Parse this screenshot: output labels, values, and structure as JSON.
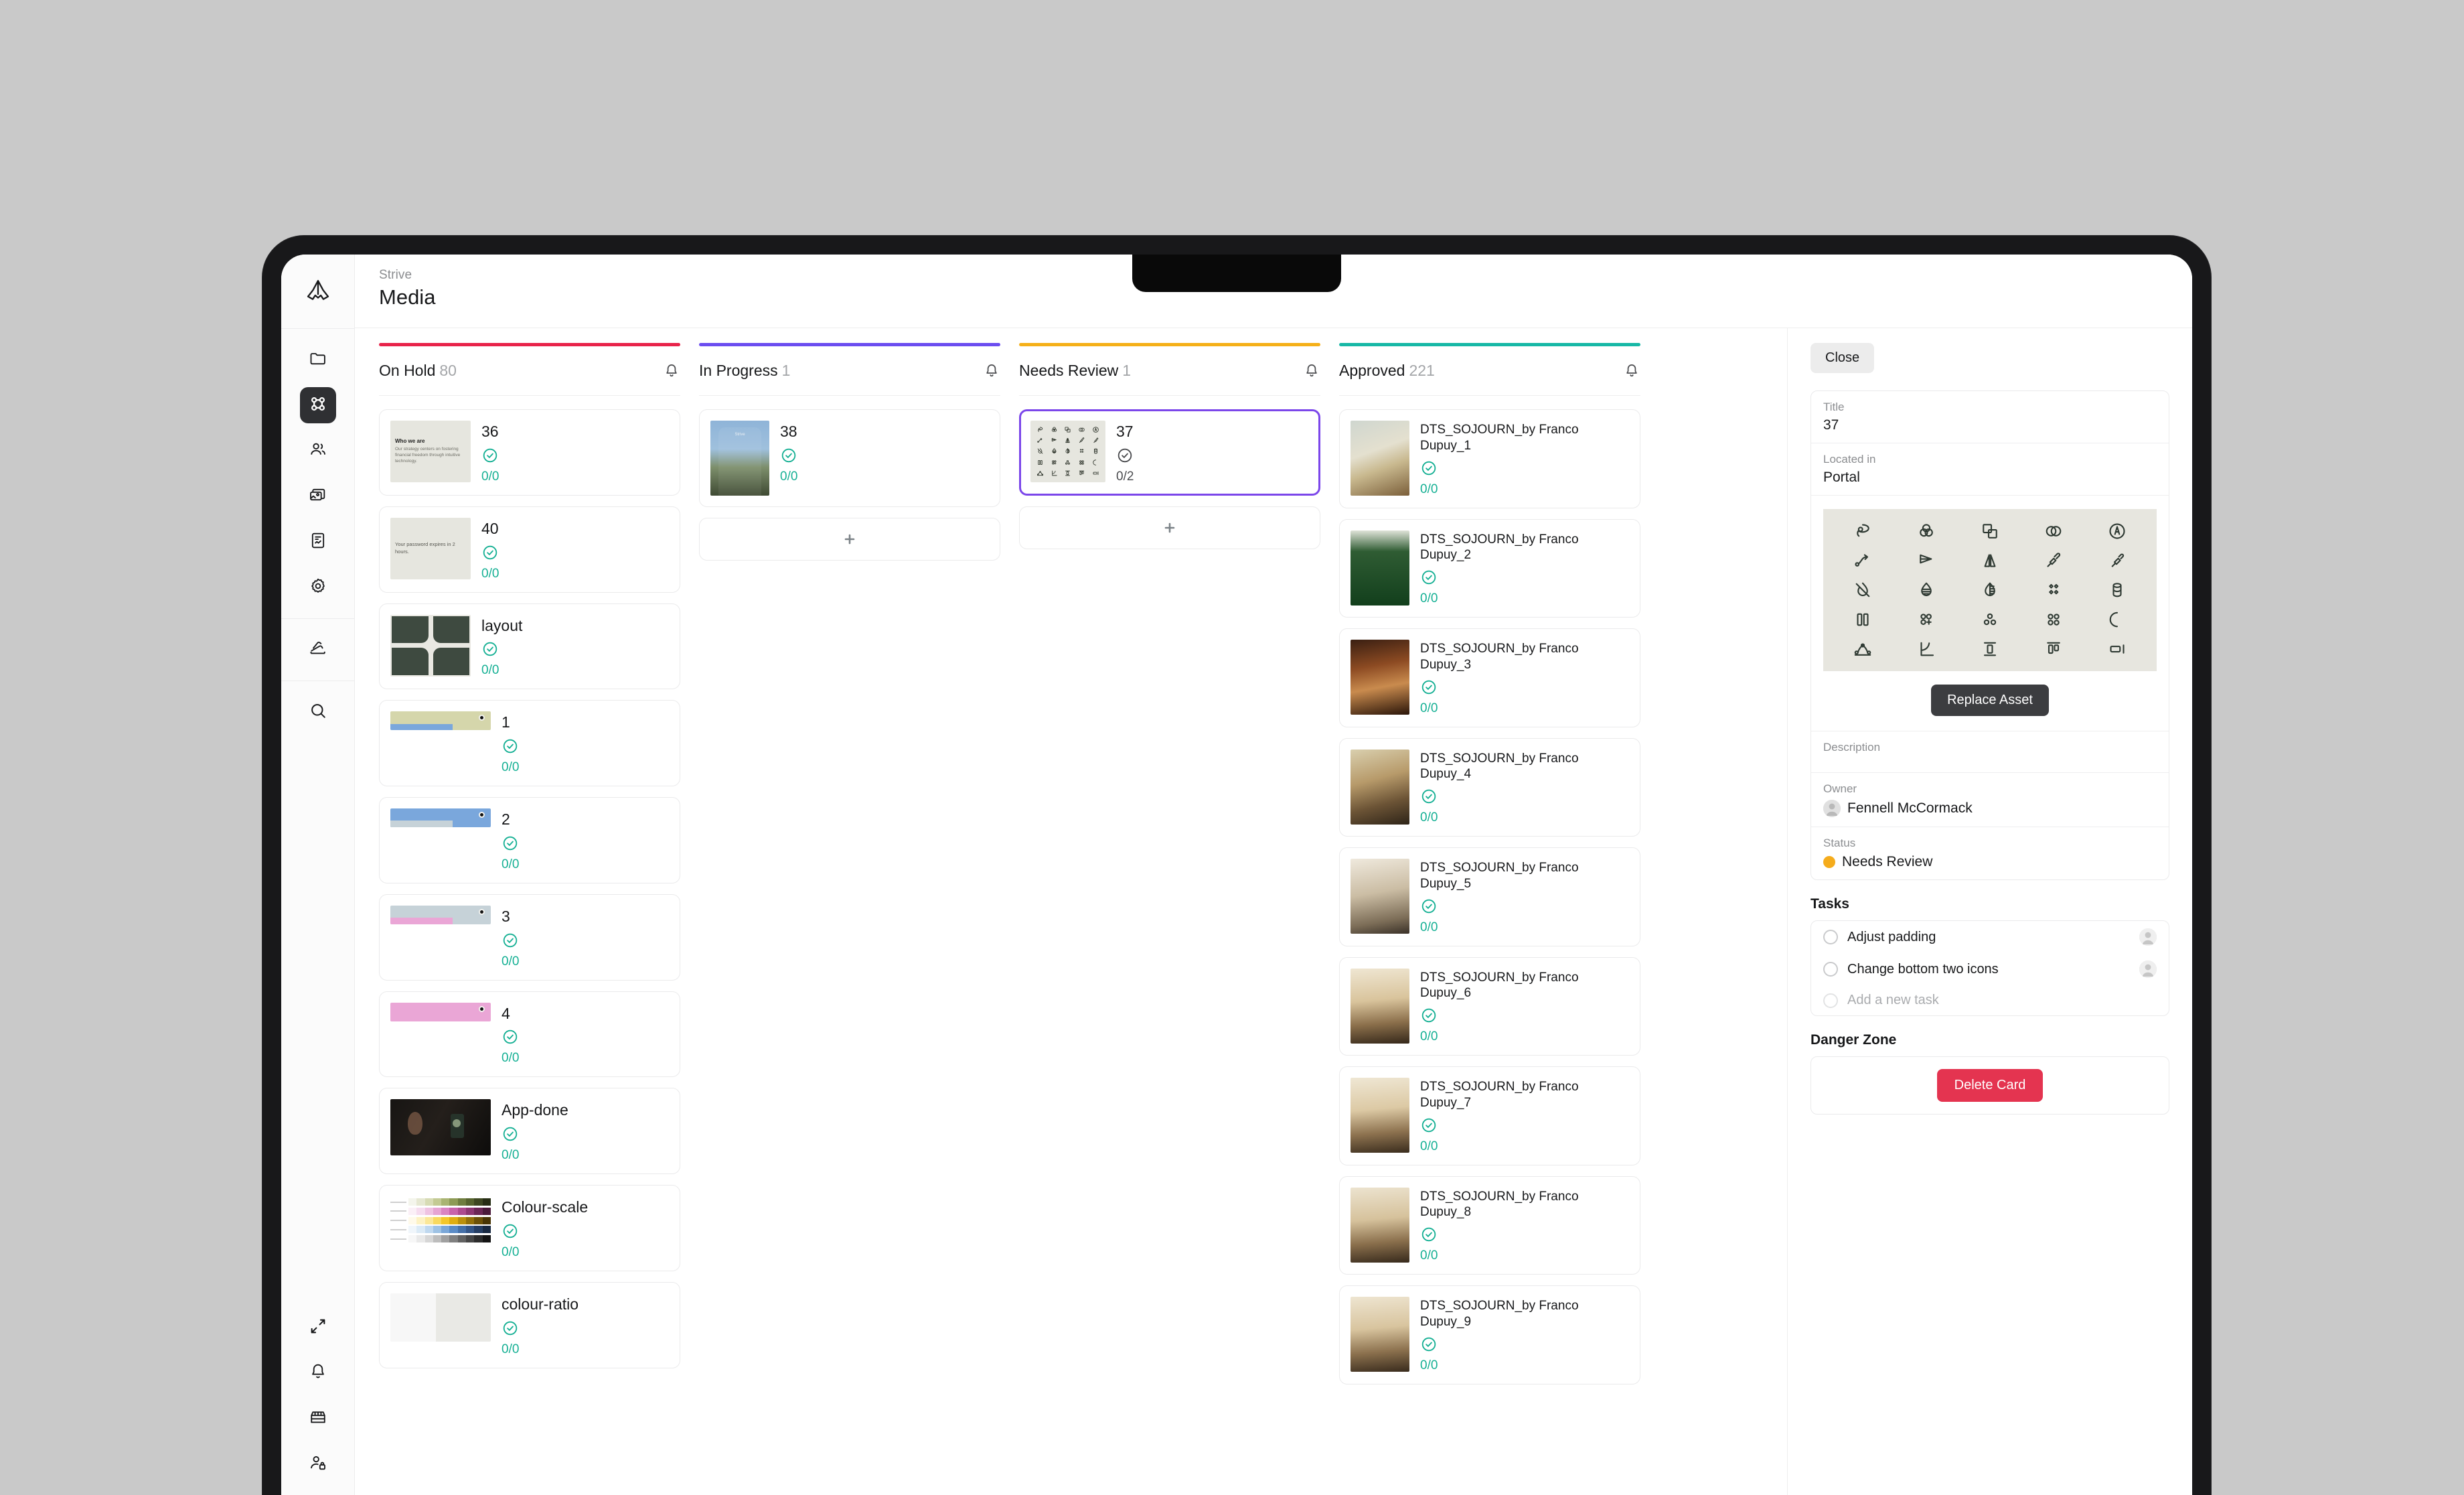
{
  "brand": {
    "logo_icon": "strive-logo-icon"
  },
  "header": {
    "breadcrumb": "Strive",
    "title": "Media"
  },
  "sidebar": {
    "top_items": [
      {
        "name": "folder",
        "icon": "folder-icon",
        "active": false
      },
      {
        "name": "board",
        "icon": "board-nodes-icon",
        "active": true
      },
      {
        "name": "people",
        "icon": "people-icon",
        "active": false
      },
      {
        "name": "media",
        "icon": "images-icon",
        "active": false
      },
      {
        "name": "reports",
        "icon": "document-chart-icon",
        "active": false
      },
      {
        "name": "settings",
        "icon": "gear-icon",
        "active": false
      }
    ],
    "mid_items": [
      {
        "name": "palette",
        "icon": "swatches-icon",
        "active": false
      }
    ],
    "search_item": {
      "name": "search",
      "icon": "search-icon"
    },
    "bottom_items": [
      {
        "name": "expand",
        "icon": "expand-arrows-icon"
      },
      {
        "name": "notifications",
        "icon": "bell-icon"
      },
      {
        "name": "store",
        "icon": "storefront-icon"
      },
      {
        "name": "account-lock",
        "icon": "user-lock-icon"
      }
    ]
  },
  "board": {
    "add_label": "+",
    "columns": [
      {
        "id": "on-hold",
        "title": "On Hold",
        "count": "80",
        "accent": "#e8234a",
        "bell_icon": "bell-icon",
        "has_add": false,
        "cards": [
          {
            "title": "36",
            "frac": "0/0",
            "thumb": "slide-who-we-are",
            "thumb_kind": "sq",
            "slide_heading": "Who we are",
            "slide_body": "Our strategy centers on fostering financial freedom through intuitive technology."
          },
          {
            "title": "40",
            "frac": "0/0",
            "thumb": "slide-password",
            "thumb_kind": "sq",
            "slide_body": "Your password expires in 2 hours."
          },
          {
            "title": "layout",
            "frac": "0/0",
            "thumb": "layout-grid",
            "thumb_kind": "sq"
          },
          {
            "title": "1",
            "frac": "0/0",
            "thumb": "bar-olive",
            "thumb_kind": "wide",
            "bar_top": "#d5d6ab",
            "bar_bottom": "#7aa7dc"
          },
          {
            "title": "2",
            "frac": "0/0",
            "thumb": "bar-blue",
            "thumb_kind": "wide",
            "bar_top": "#7aa7dc",
            "bar_bottom": "#c6d2d8"
          },
          {
            "title": "3",
            "frac": "0/0",
            "thumb": "bar-grey",
            "thumb_kind": "wide",
            "bar_top": "#c6d2d8",
            "bar_bottom": "#eaa6d6"
          },
          {
            "title": "4",
            "frac": "0/0",
            "thumb": "bar-pink",
            "thumb_kind": "wide",
            "bar_top": "#eaa6d6",
            "bar_bottom": "#eaa6d6"
          },
          {
            "title": "App-done",
            "frac": "0/0",
            "thumb": "video-dark-phone",
            "thumb_kind": "vid"
          },
          {
            "title": "Colour-scale",
            "frac": "0/0",
            "thumb": "colour-scale-palette",
            "thumb_kind": "pal"
          },
          {
            "title": "colour-ratio",
            "frac": "0/0",
            "thumb": "colour-ratio",
            "thumb_kind": "pal2"
          }
        ]
      },
      {
        "id": "in-progress",
        "title": "In Progress",
        "count": "1",
        "accent": "#6b4df0",
        "bell_icon": "bell-icon",
        "has_add": true,
        "cards": [
          {
            "title": "38",
            "frac": "0/0",
            "thumb": "photo-woman-field",
            "thumb_kind": "tall",
            "photo_label": "Strive"
          }
        ]
      },
      {
        "id": "needs-review",
        "title": "Needs Review",
        "count": "1",
        "accent": "#f5b019",
        "bell_icon": "bell-icon",
        "has_add": true,
        "cards": [
          {
            "title": "37",
            "frac": "0/2",
            "thumb": "icon-sheet",
            "thumb_kind": "iconsheet",
            "selected": true,
            "frac_grey": true
          }
        ]
      },
      {
        "id": "approved",
        "title": "Approved",
        "count": "221",
        "accent": "#17b8a6",
        "bell_icon": "bell-icon",
        "has_add": false,
        "cards": [
          {
            "title": "DTS_SOJOURN_by Franco Dupuy_1",
            "frac": "0/0",
            "thumb": "photo-desk-glasses",
            "thumb_kind": "tall",
            "small": true
          },
          {
            "title": "DTS_SOJOURN_by Franco Dupuy_2",
            "frac": "0/0",
            "thumb": "photo-green-bottles",
            "thumb_kind": "tall",
            "small": true
          },
          {
            "title": "DTS_SOJOURN_by Franco Dupuy_3",
            "frac": "0/0",
            "thumb": "photo-cafe-window",
            "thumb_kind": "tall",
            "small": true
          },
          {
            "title": "DTS_SOJOURN_by Franco Dupuy_4",
            "frac": "0/0",
            "thumb": "photo-interior-light",
            "thumb_kind": "tall",
            "small": true
          },
          {
            "title": "DTS_SOJOURN_by Franco Dupuy_5",
            "frac": "0/0",
            "thumb": "photo-room-chair",
            "thumb_kind": "tall",
            "small": true
          },
          {
            "title": "DTS_SOJOURN_by Franco Dupuy_6",
            "frac": "0/0",
            "thumb": "photo-man-shelf",
            "thumb_kind": "tall",
            "small": true
          },
          {
            "title": "DTS_SOJOURN_by Franco Dupuy_7",
            "frac": "0/0",
            "thumb": "photo-man-sitting",
            "thumb_kind": "tall",
            "small": true
          },
          {
            "title": "DTS_SOJOURN_by Franco Dupuy_8",
            "frac": "0/0",
            "thumb": "photo-man-laptop",
            "thumb_kind": "tall",
            "small": true
          },
          {
            "title": "DTS_SOJOURN_by Franco Dupuy_9",
            "frac": "0/0",
            "thumb": "photo-man-laptop-2",
            "thumb_kind": "tall",
            "small": true
          }
        ]
      }
    ]
  },
  "detail": {
    "close_label": "Close",
    "fields": [
      {
        "label": "Title",
        "value": "37"
      },
      {
        "label": "Located in",
        "value": "Portal"
      }
    ],
    "asset": {
      "replace_label": "Replace Asset",
      "icon_grid": [
        "lasso-icon",
        "colour-mix-icon",
        "combine-shapes-icon",
        "intersect-icon",
        "circle-a-icon",
        "path-arrow-icon",
        "align-right-icon",
        "flip-horizontal-icon",
        "eyedropper-icon",
        "eyedropper-2-icon",
        "no-drop-icon",
        "opacity-drop-icon",
        "contrast-drop-icon",
        "sparkle-diamond-icon",
        "cylinder-icon",
        "two-columns-icon",
        "add-dots-icon",
        "three-dots-icon",
        "four-dots-icon",
        "loading-circle-icon",
        "bezier-icon",
        "corner-angle-icon",
        "distribute-vertical-icon",
        "align-top-icon",
        "rounded-rect-icon"
      ]
    },
    "description": {
      "label": "Description",
      "value": ""
    },
    "owner": {
      "label": "Owner",
      "value": "Fennell McCormack",
      "avatar_icon": "avatar-icon"
    },
    "status": {
      "label": "Status",
      "value": "Needs Review",
      "color": "#f5ac1c"
    },
    "tasks": {
      "section_title": "Tasks",
      "items": [
        {
          "label": "Adjust padding",
          "done": false,
          "muted": false,
          "assignee_icon": "avatar-icon"
        },
        {
          "label": "Change bottom two icons",
          "done": false,
          "muted": false,
          "assignee_icon": "avatar-icon"
        },
        {
          "label": "Add a new task",
          "done": false,
          "muted": true,
          "assignee_icon": ""
        }
      ]
    },
    "danger": {
      "section_title": "Danger Zone",
      "delete_label": "Delete Card"
    }
  }
}
